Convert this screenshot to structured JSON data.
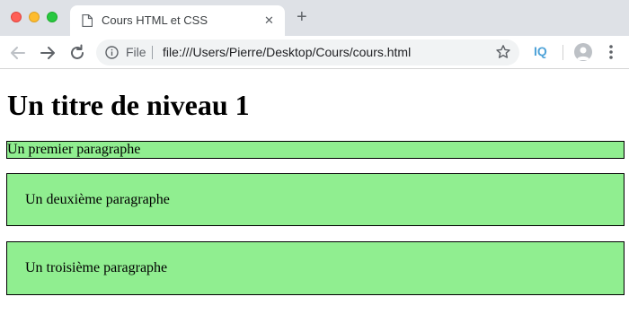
{
  "browser": {
    "tab": {
      "title": "Cours HTML et CSS",
      "icon": "page-icon",
      "close_glyph": "✕"
    },
    "new_tab_glyph": "+",
    "omnibox": {
      "scheme_label": "File",
      "url": "file:///Users/Pierre/Desktop/Cours/cours.html"
    },
    "extension_label": "IQ"
  },
  "page": {
    "heading": "Un titre de niveau 1",
    "paragraphs": [
      "Un premier paragraphe",
      "Un deuxième paragraphe",
      "Un troisième paragraphe"
    ],
    "paragraph_background": "#90ee90",
    "paragraph_border": "#000000"
  }
}
